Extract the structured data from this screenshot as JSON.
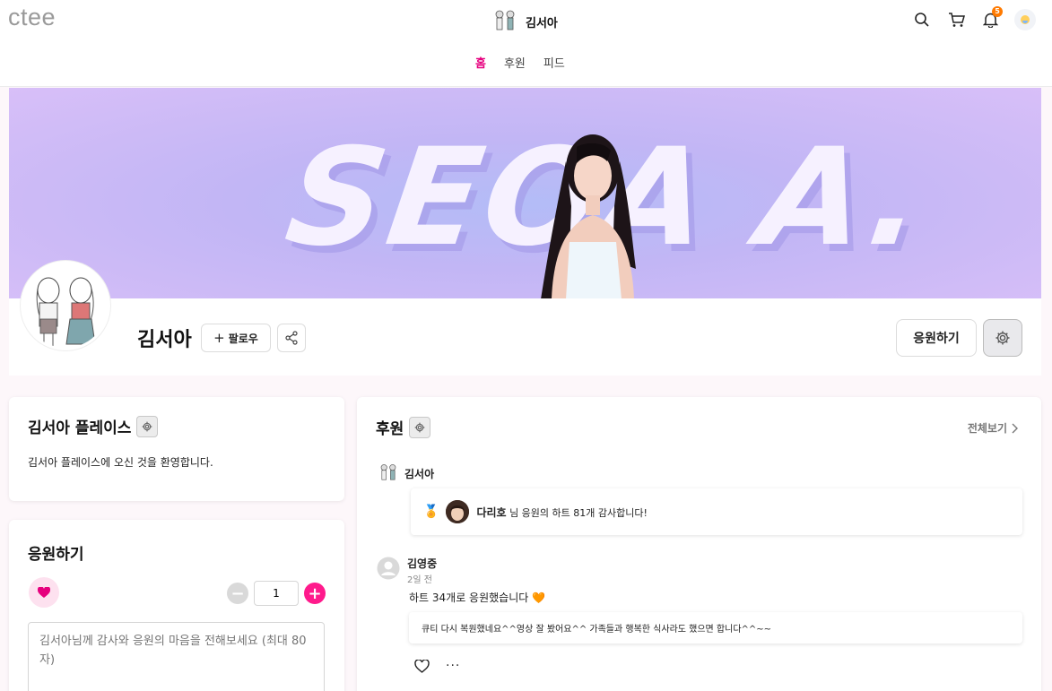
{
  "header": {
    "logo": "ctee",
    "creator_name": "김서아",
    "nav": [
      "홈",
      "후원",
      "피드"
    ],
    "active_nav": "홈",
    "notification_count": "5"
  },
  "banner": {
    "text": "SEOA A."
  },
  "profile": {
    "name": "김서아",
    "follow_label": "팔로우",
    "support_label": "응원하기"
  },
  "place": {
    "title": "김서아 플레이스",
    "description": "김서아 플레이스에 오신 것을 환영합니다."
  },
  "support": {
    "title": "응원하기",
    "quantity": "1",
    "placeholder": "김서아님께 감사와 응원의 마음을 전해보세요 (최대 80자)"
  },
  "feed": {
    "title": "후원",
    "view_all": "전체보기",
    "creator_name": "김서아",
    "thanks": {
      "supporter": "다리호",
      "text": "님 응원의 하트 81개 감사합니다!"
    },
    "post": {
      "name": "김영중",
      "time": "2일 전",
      "message": "하트 34개로 응원했습니다 🧡",
      "comment": "큐티 다시 복원했네요^^영상 잘 봤어요^^ 가족들과 행복한 식사라도 했으면 합니다^^~~"
    }
  },
  "colors": {
    "accent": "#e6007e",
    "plus": "#ff1a8c",
    "badge": "#ff7a00"
  }
}
